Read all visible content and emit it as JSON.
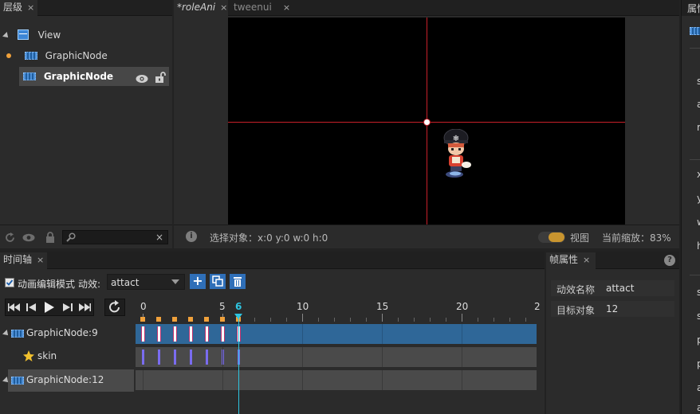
{
  "hierarchy": {
    "tab_label": "层级",
    "tab_close": "×",
    "items": [
      {
        "label": "View"
      },
      {
        "label": "GraphicNode"
      },
      {
        "label": "GraphicNode"
      }
    ]
  },
  "editor": {
    "tabs": [
      {
        "label": "*roleAni",
        "close": "×"
      },
      {
        "label": "tweenui",
        "close": "×"
      }
    ],
    "status": {
      "info_icon": "i",
      "selection_text": "选择对象：x:0 y:0  w:0 h:0",
      "view_label": "视图",
      "zoom_text": "当前缩放：83%"
    }
  },
  "properties_panel": {
    "tab_label": "属性"
  },
  "timeline": {
    "tab_label": "时间轴",
    "tab_close": "×",
    "edit_mode_label": "动画编辑模式",
    "edit_mode_checked": true,
    "effect_label": "动效:",
    "effect_value": "attact",
    "add_glyph": "+",
    "frame_numbers": [
      "0",
      "5",
      "6",
      "10",
      "15",
      "20",
      "2"
    ],
    "current_frame": 6,
    "tracks": [
      {
        "label": "GraphicNode:9"
      },
      {
        "label": "skin"
      },
      {
        "label": "GraphicNode:12"
      }
    ]
  },
  "frame_props": {
    "tab_label": "帧属性",
    "tab_close": "×",
    "help_glyph": "?",
    "rows": [
      {
        "label": "动效名称",
        "value": "attact"
      },
      {
        "label": "目标对象",
        "value": "12"
      }
    ]
  },
  "right_partial_letters": [
    "s",
    "a",
    "r",
    "x",
    "y",
    "w",
    "h",
    "s",
    "s",
    "p",
    "p",
    "a",
    "a"
  ],
  "colors": {
    "track_blue": "#2f6798",
    "track_gray": "#4a4a4a",
    "playhead": "#2ec5e0",
    "crosshair": "#c8202a",
    "keyframe_orange": "#f0a13b"
  }
}
